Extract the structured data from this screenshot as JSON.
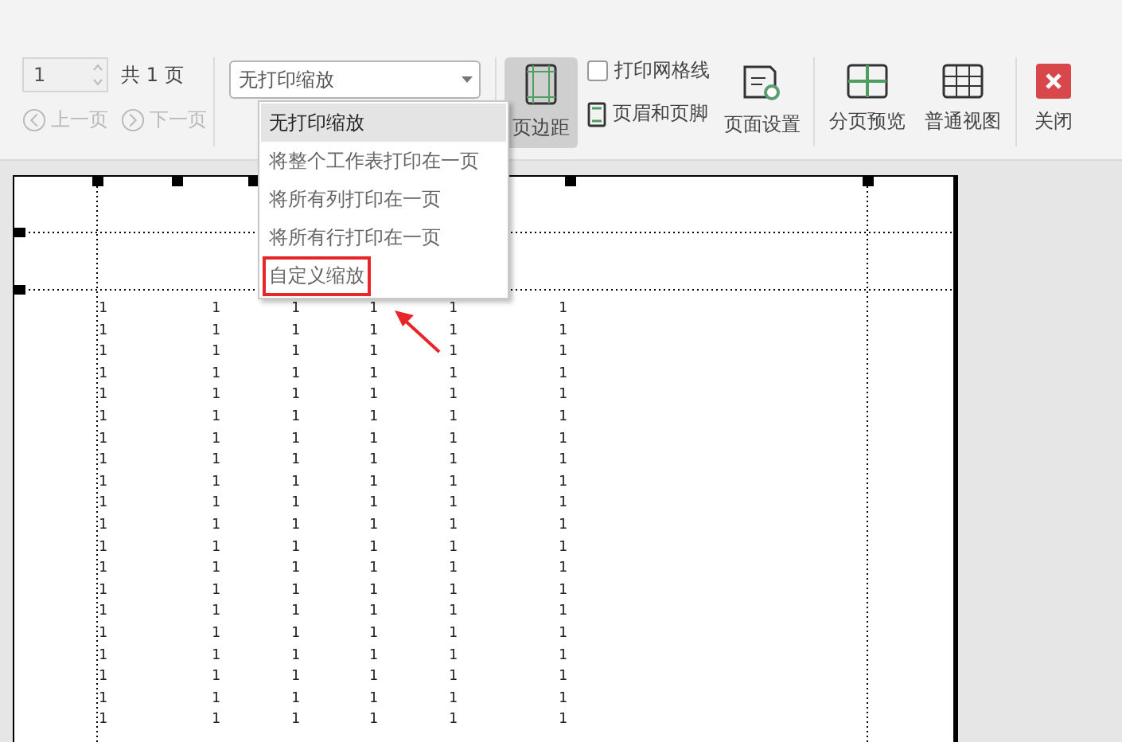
{
  "toolbar": {
    "page_field": {
      "value": "1"
    },
    "page_count": "共 1 页",
    "nav": [
      {
        "label": "上一页",
        "kind": "prev",
        "disabled": true
      },
      {
        "label": "下一页",
        "kind": "next",
        "disabled": true
      }
    ],
    "scale_select": {
      "value": "无打印缩放",
      "expanded": true,
      "options": [
        {
          "label": "无打印缩放",
          "selected": true,
          "annotated": false
        },
        {
          "label": "将整个工作表打印在一页",
          "selected": false,
          "annotated": false
        },
        {
          "label": "将所有列打印在一页",
          "selected": false,
          "annotated": false
        },
        {
          "label": "将所有行打印在一页",
          "selected": false,
          "annotated": false
        },
        {
          "label": "自定义缩放",
          "selected": false,
          "annotated": true
        }
      ]
    },
    "margins": {
      "label": "页边距",
      "pressed": true
    },
    "print_gridlines": {
      "label": "打印网格线",
      "checked": false
    },
    "header_footer": {
      "label": "页眉和页脚"
    },
    "page_setup": {
      "label": "页面设置"
    },
    "view_tools": [
      {
        "label": "分页预览",
        "kind": "pagebreak"
      },
      {
        "label": "普通视图",
        "kind": "normal"
      }
    ],
    "close": {
      "label": "关闭"
    }
  },
  "sheet": {
    "rows": [
      [
        "1",
        "1",
        "1",
        "1",
        "1",
        "1"
      ],
      [
        "1",
        "1",
        "1",
        "1",
        "1",
        "1"
      ],
      [
        "1",
        "1",
        "1",
        "1",
        "1",
        "1"
      ],
      [
        "1",
        "1",
        "1",
        "1",
        "1",
        "1"
      ],
      [
        "1",
        "1",
        "1",
        "1",
        "1",
        "1"
      ],
      [
        "1",
        "1",
        "1",
        "1",
        "1",
        "1"
      ],
      [
        "1",
        "1",
        "1",
        "1",
        "1",
        "1"
      ],
      [
        "1",
        "1",
        "1",
        "1",
        "1",
        "1"
      ],
      [
        "1",
        "1",
        "1",
        "1",
        "1",
        "1"
      ],
      [
        "1",
        "1",
        "1",
        "1",
        "1",
        "1"
      ],
      [
        "1",
        "1",
        "1",
        "1",
        "1",
        "1"
      ],
      [
        "1",
        "1",
        "1",
        "1",
        "1",
        "1"
      ],
      [
        "1",
        "1",
        "1",
        "1",
        "1",
        "1"
      ],
      [
        "1",
        "1",
        "1",
        "1",
        "1",
        "1"
      ],
      [
        "1",
        "1",
        "1",
        "1",
        "1",
        "1"
      ],
      [
        "1",
        "1",
        "1",
        "1",
        "1",
        "1"
      ],
      [
        "1",
        "1",
        "1",
        "1",
        "1",
        "1"
      ],
      [
        "1",
        "1",
        "1",
        "1",
        "1",
        "1"
      ],
      [
        "1",
        "1",
        "1",
        "1",
        "1",
        "1"
      ],
      [
        "1",
        "1",
        "1",
        "1",
        "1",
        "1"
      ]
    ]
  }
}
